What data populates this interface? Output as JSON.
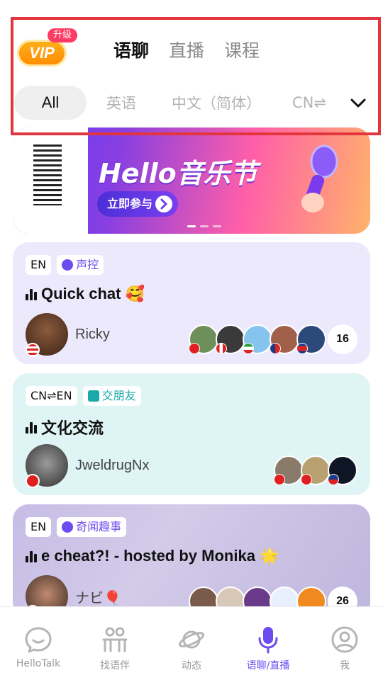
{
  "header": {
    "vip_label": "VIP",
    "upgrade_badge": "升级",
    "top_tabs": [
      {
        "label": "语聊",
        "active": true
      },
      {
        "label": "直播",
        "active": false
      },
      {
        "label": "课程",
        "active": false
      }
    ],
    "sub_tabs": [
      "All",
      "英语",
      "中文（简体）",
      "CN⇌"
    ],
    "active_sub_tab": "All"
  },
  "banner": {
    "title": "Hello音乐节",
    "cta_label": "立即参与",
    "page_indicator": {
      "count": 3,
      "active": 0
    }
  },
  "rooms": [
    {
      "language_tag": "EN",
      "topic": "声控",
      "title": "Quick chat 🥰",
      "host_name": "Ricky",
      "audience_count": "16",
      "background": "#ede9fd",
      "topic_color": "#6c4cf0"
    },
    {
      "language_tag": "CN⇌EN",
      "topic": "交朋友",
      "title": "文化交流",
      "host_name": "JweldrugNx",
      "audience_count": "",
      "background": "#dff4f4",
      "topic_color": "#1aa8a8"
    },
    {
      "language_tag": "EN",
      "topic": "奇闻趣事",
      "title": "e cheat?! - hosted by Monika 🌟",
      "host_name": "ナビ🎈",
      "audience_count": "26",
      "background": "#cbc3e6",
      "topic_color": "#6c4cf0"
    }
  ],
  "bottom_nav": [
    {
      "label": "HelloTalk",
      "icon": "chat-bubble-icon",
      "active": false
    },
    {
      "label": "找语伴",
      "icon": "partners-icon",
      "active": false
    },
    {
      "label": "动态",
      "icon": "planet-icon",
      "active": false
    },
    {
      "label": "语聊/直播",
      "icon": "microphone-icon",
      "active": true
    },
    {
      "label": "我",
      "icon": "profile-icon",
      "active": false
    }
  ],
  "colors": {
    "accent": "#6c4cf0",
    "highlight_border": "#e3353c",
    "vip_orange": "#ff8a00",
    "upgrade_red": "#ff3b63"
  }
}
